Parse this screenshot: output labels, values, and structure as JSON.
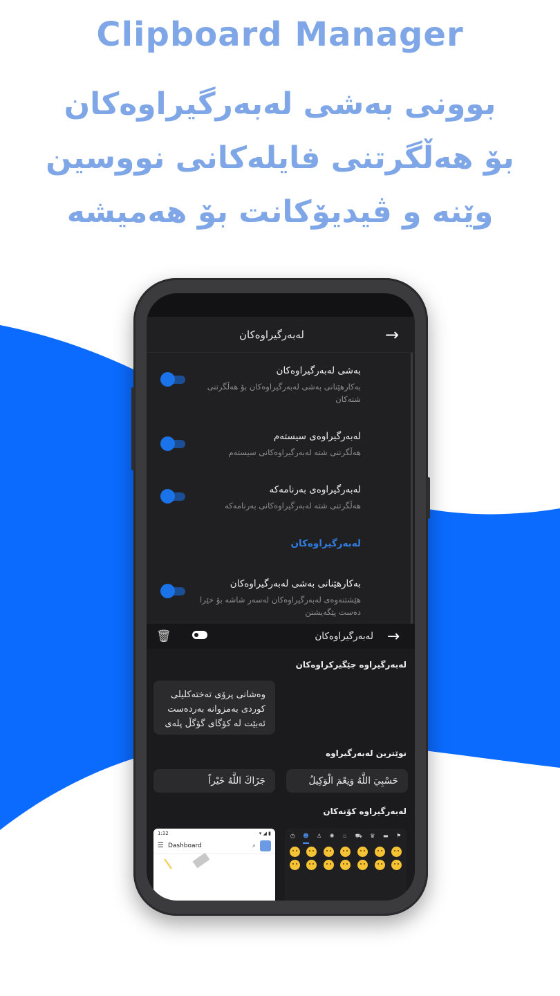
{
  "header": {
    "app_title": "Clipboard Manager",
    "tagline_line1": "بوونی بەشی لەبەرگیراوەکان",
    "tagline_line2": "بۆ هەڵگرتنی فایلەکانی نووسین",
    "tagline_line3": "وێنە و ڤیدیۆکانت بۆ هەمیشە"
  },
  "colors": {
    "accent_blue": "#0b6bff",
    "heading_blue": "#7fa6e6",
    "toggle_on": "#1a73e8",
    "dark_bg": "#202022"
  },
  "settings": {
    "title": "لەبەرگیراوەکان",
    "items": [
      {
        "title": "بەشی لەبەرگیراوەکان",
        "description": "بەکارهێنانی بەشی لەبەرگیراوەکان بۆ هەڵگرتنی شتەکان",
        "enabled": true
      },
      {
        "title": "لەبەرگیراوەی سیستەم",
        "description": "هەڵگرتنی شتە لەبەرگیراوەکانی سیستەم",
        "enabled": true
      },
      {
        "title": "لەبەرگیراوەی بەرنامەکە",
        "description": "هەڵگرتنی شتە لەبەرگیراوەکانی بەرنامەکە",
        "enabled": true
      }
    ],
    "section_header": "لەبەرگیراوەکان",
    "section_items": [
      {
        "title": "بەکارهێنانی بەشی لەبەرگیراوەکان",
        "description": "هێشتنەوەی لەبەرگیراوەکان لەسەر شاشە بۆ خێرا دەست پێگەیشتن",
        "enabled": true
      }
    ]
  },
  "clipboard": {
    "title": "لەبەرگیراوەکان",
    "pinned_header": "لەبەرگیراوە جێگیرکراوەکان",
    "pinned_text": "وەشانی پرۆی تەختەکلیلی کوردی بەمزوانە بەردەست ئەبێت لە کۆگای گۆگڵ پلەی",
    "recent_header": "نوێترین لەبەرگیراوە",
    "recent_items": [
      "حَسْبِيَ اللَّهُ وَنِعْمَ الْوَكِيلُ",
      "جَزَاكَ اللَّهُ خَيْراً"
    ],
    "old_header": "لەبەرگیراوە کۆنەکان",
    "screenshot_time": "1:32",
    "screenshot_title": "Dashboard"
  },
  "icons": [
    "back-arrow-icon",
    "trash-icon",
    "toggle-icon",
    "menu-icon",
    "search-icon",
    "emoji-icon"
  ]
}
